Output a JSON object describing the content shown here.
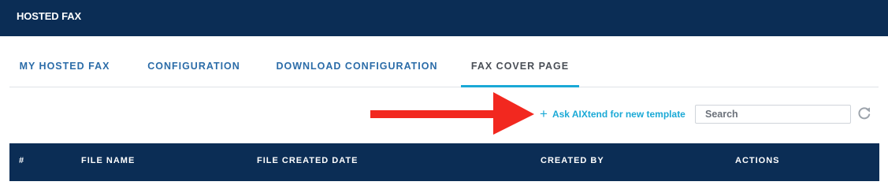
{
  "header": {
    "title": "HOSTED FAX"
  },
  "tabs": [
    {
      "label": "MY HOSTED FAX"
    },
    {
      "label": "CONFIGURATION"
    },
    {
      "label": "DOWNLOAD CONFIGURATION"
    },
    {
      "label": "FAX COVER PAGE"
    }
  ],
  "active_tab": "FAX COVER PAGE",
  "toolbar": {
    "plus_icon": "+",
    "ask_label": "Ask AIXtend for new template",
    "search_placeholder": "Search",
    "refresh_icon": "refresh-icon"
  },
  "annotation": {
    "arrow_color": "#f2281f"
  },
  "table": {
    "columns": [
      "#",
      "FILE NAME",
      "FILE CREATED DATE",
      "CREATED BY",
      "ACTIONS"
    ]
  },
  "colors": {
    "header_bg": "#0b2d55",
    "tab_text": "#2b6ca8",
    "active_tab_underline": "#1aa9d6",
    "link": "#1aa9d6"
  }
}
